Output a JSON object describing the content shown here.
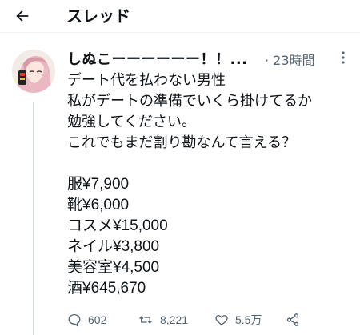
{
  "topbar": {
    "title": "スレッド",
    "back_icon": "arrow-left-icon"
  },
  "tweet": {
    "author_name": "しぬこーーーーーー！！...",
    "time": "· 23時間",
    "more_icon": "more-vertical-icon",
    "text_lines": [
      "デート代を払わない男性",
      "私がデートの準備でいくら掛けてるか",
      "勉強してください。",
      "これでもまだ割り勘なんて言える？"
    ],
    "price_lines": [
      "服¥7,900",
      "靴¥6,000",
      "コスメ¥15,000",
      "ネイル¥3,800",
      "美容室¥4,500",
      "酒¥645,670"
    ],
    "actions": {
      "reply_count": "602",
      "retweet_count": "8,221",
      "like_count": "5.5万"
    }
  },
  "colors": {
    "text": "#0f1419",
    "muted": "#536471",
    "thread_line": "#cfd9de"
  }
}
